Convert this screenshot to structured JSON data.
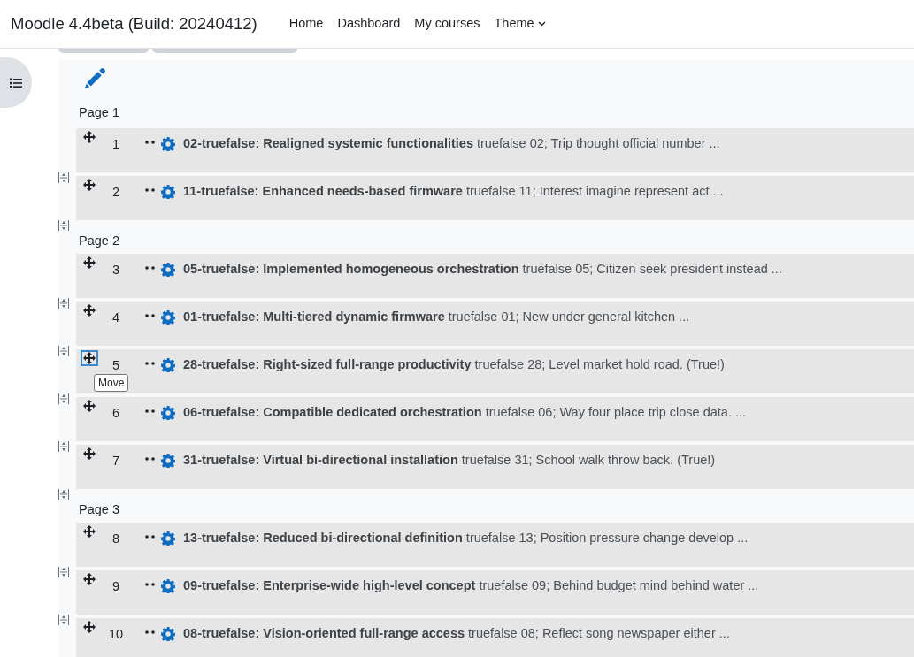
{
  "navbar": {
    "brand": "Moodle 4.4beta (Build: 20240412)",
    "links": [
      {
        "label": "Home",
        "kind": "link"
      },
      {
        "label": "Dashboard",
        "kind": "link"
      },
      {
        "label": "My courses",
        "kind": "link"
      },
      {
        "label": "Theme",
        "kind": "dropdown"
      }
    ]
  },
  "pages": [
    {
      "label": "Page 1",
      "questions": [
        {
          "number": "1",
          "name": "02-truefalse: Realigned systemic functionalities",
          "summary": "truefalse 02; Trip thought official number ...",
          "move_focused": false
        },
        {
          "number": "2",
          "name": "11-truefalse: Enhanced needs-based firmware",
          "summary": "truefalse 11; Interest imagine represent act ...",
          "move_focused": false
        }
      ]
    },
    {
      "label": "Page 2",
      "questions": [
        {
          "number": "3",
          "name": "05-truefalse: Implemented homogeneous orchestration",
          "summary": "truefalse 05; Citizen seek president instead ...",
          "move_focused": false
        },
        {
          "number": "4",
          "name": "01-truefalse: Multi-tiered dynamic firmware",
          "summary": "truefalse 01; New under general kitchen ...",
          "move_focused": false
        },
        {
          "number": "5",
          "name": "28-truefalse: Right-sized full-range productivity",
          "summary": "truefalse 28; Level market hold road. (True!)",
          "move_focused": true,
          "tooltip": "Move"
        },
        {
          "number": "6",
          "name": "06-truefalse: Compatible dedicated orchestration",
          "summary": "truefalse 06; Way four place trip close data. ...",
          "move_focused": false
        },
        {
          "number": "7",
          "name": "31-truefalse: Virtual bi-directional installation",
          "summary": "truefalse 31; School walk throw back. (True!)",
          "move_focused": false
        }
      ]
    },
    {
      "label": "Page 3",
      "questions": [
        {
          "number": "8",
          "name": "13-truefalse: Reduced bi-directional definition",
          "summary": "truefalse 13; Position pressure change develop ...",
          "move_focused": false
        },
        {
          "number": "9",
          "name": "09-truefalse: Enterprise-wide high-level concept",
          "summary": "truefalse 09; Behind budget mind behind water ...",
          "move_focused": false
        },
        {
          "number": "10",
          "name": "08-truefalse: Vision-oriented full-range access",
          "summary": "truefalse 08; Reflect song newspaper either ...",
          "move_focused": false
        }
      ]
    }
  ]
}
